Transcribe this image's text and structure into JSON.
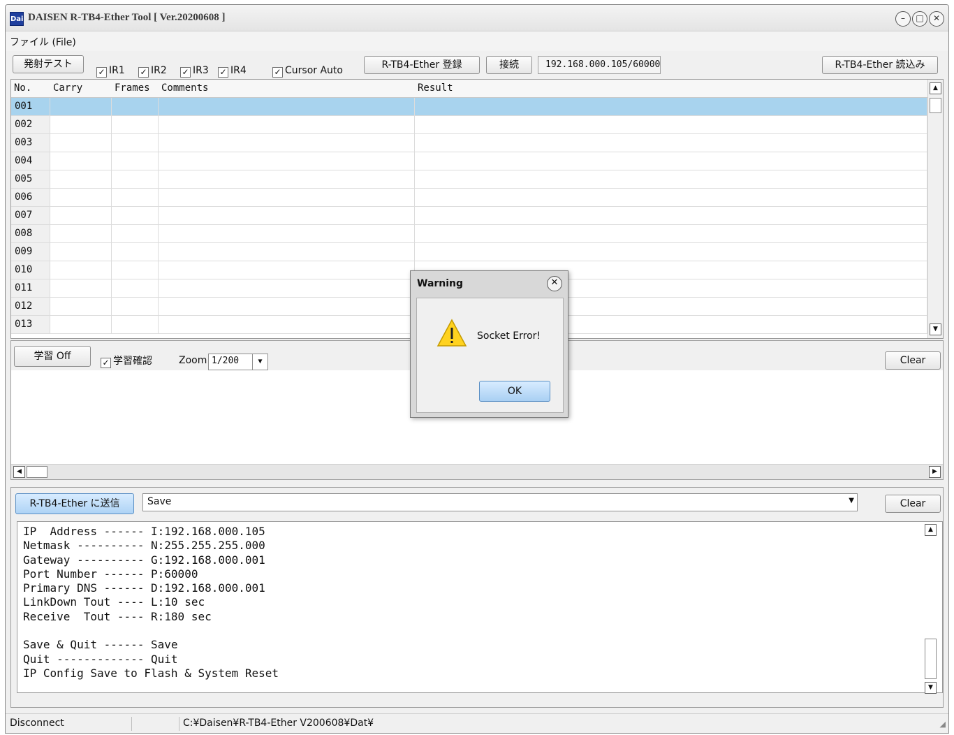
{
  "window": {
    "title": "DAISEN R-TB4-Ether Tool  [ Ver.20200608 ]",
    "icon_label": "Dai"
  },
  "menu": {
    "file": "ファイル (File)"
  },
  "toolbar": {
    "fire_test": "発射テスト",
    "ir1": "IR1",
    "ir2": "IR2",
    "ir3": "IR3",
    "ir4": "IR4",
    "cursor_auto": "Cursor Auto",
    "register": "R-TB4-Ether 登録",
    "connect": "接続",
    "ip_port": "192.168.000.105/60000",
    "read": "R-TB4-Ether 読込み"
  },
  "grid": {
    "columns": [
      "No.",
      "Carry",
      "Frames",
      "Comments",
      "Result"
    ],
    "rows": [
      "001",
      "002",
      "003",
      "004",
      "005",
      "006",
      "007",
      "008",
      "009",
      "010",
      "011",
      "012",
      "013"
    ],
    "selected_row": "001"
  },
  "learn": {
    "learn_off": "学習 Off",
    "learn_confirm": "学習確認",
    "zoom_label": "Zoom",
    "zoom_value": "1/200",
    "clear": "Clear"
  },
  "send": {
    "send_button": "R-TB4-Ether に送信",
    "command_value": "Save",
    "clear": "Clear"
  },
  "log": {
    "lines": [
      "IP  Address ------ I:192.168.000.105",
      "Netmask ---------- N:255.255.255.000",
      "Gateway ---------- G:192.168.000.001",
      "Port Number ------ P:60000",
      "Primary DNS ------ D:192.168.000.001",
      "LinkDown Tout ---- L:10 sec",
      "Receive  Tout ---- R:180 sec",
      "",
      "Save & Quit ------ Save",
      "Quit ------------- Quit",
      "IP Config Save to Flash & System Reset"
    ]
  },
  "status": {
    "connection": "Disconnect",
    "path": "C:¥Daisen¥R-TB4-Ether V200608¥Dat¥"
  },
  "dialog": {
    "title": "Warning",
    "message": "Socket Error!",
    "ok": "OK"
  },
  "colors": {
    "selection": "#a8d3ee",
    "button_blue": "#aed3f5",
    "warning_yellow": "#ffd21f"
  }
}
